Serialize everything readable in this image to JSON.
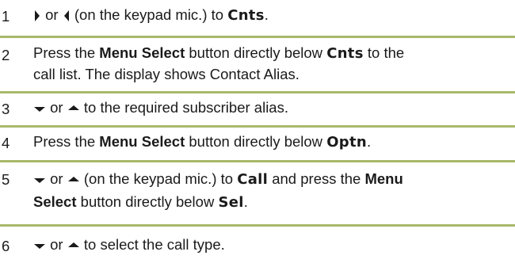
{
  "steps": [
    {
      "number": "1",
      "text": [
        "(on the keypad mic.) to",
        "Cnts",
        "."
      ],
      "connector": "or"
    },
    {
      "number": "2",
      "line1": [
        "Press the",
        "Menu Select",
        "button directly below",
        "Cnts",
        "to the"
      ],
      "line2": "call list. The display shows Contact Alias."
    },
    {
      "number": "3",
      "connector": "or",
      "text": "to the required subscriber alias."
    },
    {
      "number": "4",
      "parts": [
        "Press the",
        "Menu Select",
        "button directly below",
        "Optn",
        "."
      ]
    },
    {
      "number": "5",
      "line1": [
        "or",
        "(on the keypad mic.) to",
        "Call",
        "and press the",
        "Menu"
      ],
      "line2": [
        "Select",
        "button directly below",
        "Sel",
        "."
      ]
    },
    {
      "number": "6",
      "connector": "or",
      "text": "to select the call type."
    }
  ],
  "icons": [
    "right-arrow-icon",
    "left-arrow-icon",
    "down-arrow-icon",
    "up-arrow-icon"
  ],
  "colors": {
    "divider": "#a8b96a",
    "text": "#1a1a1a"
  }
}
